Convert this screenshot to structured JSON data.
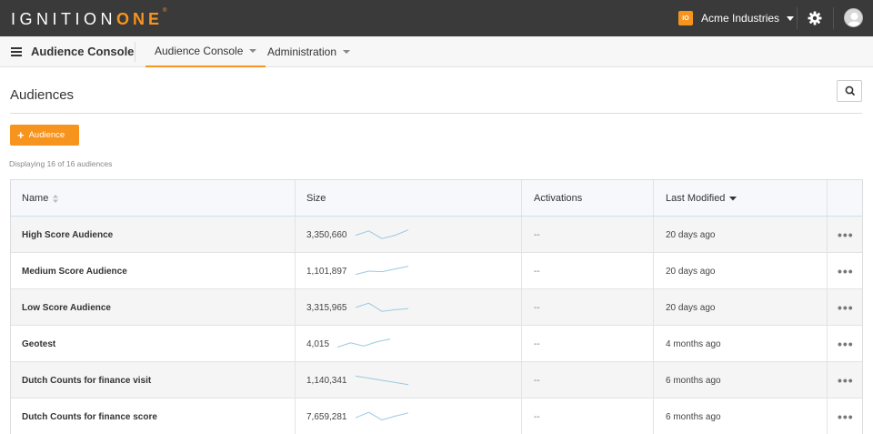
{
  "brand": {
    "logo_text": "IGNITION",
    "logo_accent": "ONE",
    "logo_mark": "®",
    "accent_color": "#f7941d"
  },
  "topbar": {
    "org_badge": "IO",
    "org_name": "Acme Industries"
  },
  "subnav": {
    "app_title": "Audience Console",
    "tabs": [
      {
        "label": "Audience Console",
        "active": true
      },
      {
        "label": "Administration",
        "active": false
      }
    ]
  },
  "page": {
    "title": "Audiences",
    "add_button": "Audience",
    "count_text": "Displaying 16 of 16 audiences"
  },
  "table": {
    "columns": [
      "Name",
      "Size",
      "Activations",
      "Last Modified"
    ],
    "rows": [
      {
        "name": "High Score Audience",
        "size": "3,350,660",
        "activations": "--",
        "modified": "20 days ago",
        "trend": [
          0.45,
          0.85,
          0.15,
          0.45,
          0.95
        ]
      },
      {
        "name": "Medium Score Audience",
        "size": "1,101,897",
        "activations": "--",
        "modified": "20 days ago",
        "trend": [
          0.2,
          0.5,
          0.45,
          0.7,
          0.95
        ]
      },
      {
        "name": "Low Score Audience",
        "size": "3,315,965",
        "activations": "--",
        "modified": "20 days ago",
        "trend": [
          0.5,
          0.9,
          0.15,
          0.3,
          0.4
        ]
      },
      {
        "name": "Geotest",
        "size": "4,015",
        "activations": "--",
        "modified": "4 months ago",
        "trend": [
          0.2,
          0.6,
          0.3,
          0.7,
          0.95
        ]
      },
      {
        "name": "Dutch Counts for finance visit",
        "size": "1,140,341",
        "activations": "--",
        "modified": "6 months ago",
        "trend": [
          0.9,
          0.7,
          0.5,
          0.3,
          0.1
        ]
      },
      {
        "name": "Dutch Counts for finance score",
        "size": "7,659,281",
        "activations": "--",
        "modified": "6 months ago",
        "trend": [
          0.4,
          0.9,
          0.2,
          0.55,
          0.85
        ]
      }
    ],
    "row_menu": "•••"
  }
}
